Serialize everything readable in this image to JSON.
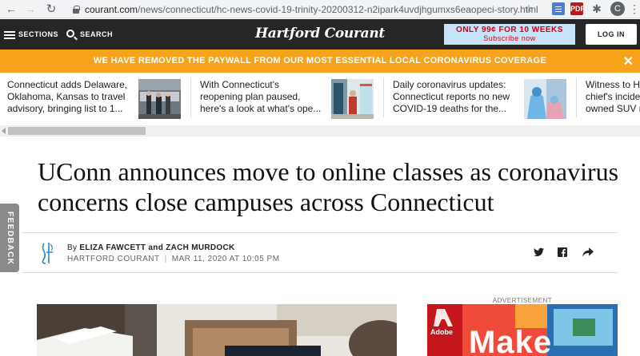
{
  "browser": {
    "url_host": "courant.com",
    "url_path": "/news/connecticut/hc-news-covid-19-trinity-20200312-n2ipark4uvdjhgumxs6eaopeci-story.html",
    "profile_initial": "C",
    "pdf_ext_label": "PDF"
  },
  "header": {
    "sections_label": "SECTIONS",
    "search_label": "SEARCH",
    "logo_text": "Hartford Courant",
    "subscribe_main": "ONLY 99¢ FOR 10 WEEKS",
    "subscribe_sub": "Subscribe now",
    "login_label": "LOG IN"
  },
  "promo": {
    "text": "WE HAVE REMOVED THE PAYWALL FROM OUR MOST ESSENTIAL LOCAL CORONAVIRUS COVERAGE",
    "close": "✕"
  },
  "rail": {
    "items": [
      {
        "line1": "Connecticut adds Delaware,",
        "line2": "Oklahoma, Kansas to travel",
        "line3": "advisory, bringing list to 1..."
      },
      {
        "line1": "With Connecticut's",
        "line2": "reopening plan paused,",
        "line3": "here's a look at what's ope..."
      },
      {
        "line1": "Daily coronavirus updates:",
        "line2": "Connecticut reports no new",
        "line3": "COVID-19 deaths for the..."
      },
      {
        "line1": "Witness to H",
        "line2": "chief's incide",
        "line3": "owned SUV r"
      }
    ]
  },
  "article": {
    "headline_line1": "UConn announces move to online classes as coronavirus",
    "headline_line2": "concerns close campuses across Connecticut",
    "byline_prefix": "By",
    "authors": "ELIZA FAWCETT and ZACH MURDOCK",
    "publication": "HARTFORD COURANT",
    "date": "MAR 11, 2020 AT 10:05 PM"
  },
  "feedback_label": "FEEDBACK",
  "ad": {
    "label": "ADVERTISEMENT",
    "brand": "Adobe",
    "headline": "Make"
  },
  "colors": {
    "promo_bar": "#f7a21b",
    "header_bg": "#262626",
    "subscribe_bg": "#c6e3f7",
    "subscribe_text": "#d0021b"
  }
}
